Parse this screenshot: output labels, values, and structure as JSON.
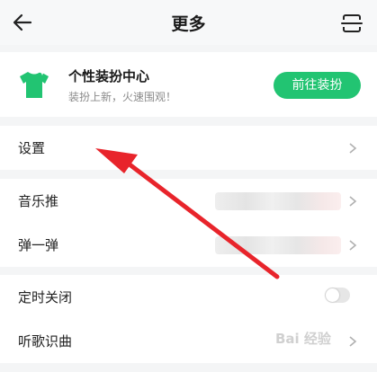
{
  "header": {
    "title": "更多"
  },
  "card": {
    "title": "个性装扮中心",
    "subtitle": "装扮上新，火速围观！",
    "button_label": "前往装扮",
    "accent": "#22c472"
  },
  "settings": [
    {
      "label": "设置"
    }
  ],
  "group2": [
    {
      "label": "音乐推"
    },
    {
      "label": "弹一弹"
    }
  ],
  "group3": [
    {
      "label": "定时关闭",
      "toggle_on": false
    },
    {
      "label": "听歌识曲"
    }
  ],
  "watermark": "Bai 经验",
  "icons": {
    "back": "back-arrow-icon",
    "scan": "scan-icon",
    "shirt": "tshirt-icon",
    "chevron": "chevron-right-icon"
  }
}
